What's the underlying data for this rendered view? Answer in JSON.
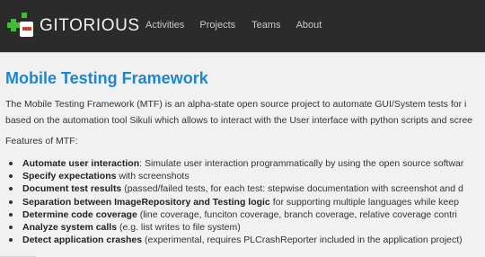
{
  "header": {
    "logo_text": "GITORIOUS",
    "logo_icon": "gitorious-plus-minus-icon",
    "nav": [
      {
        "label": "Activities"
      },
      {
        "label": "Projects"
      },
      {
        "label": "Teams"
      },
      {
        "label": "About"
      }
    ],
    "colors": {
      "bar": "#2b2b2b",
      "logo_green": "#3fbf2f",
      "logo_red": "#d23a2e"
    }
  },
  "main": {
    "title": "Mobile Testing Framework",
    "intro_line1": "The Mobile Testing Framework (MTF) is an alpha-state open source project to automate GUI/System tests for i",
    "intro_line2": "based on the automation tool Sikuli which allows to interact with the User interface with python scripts and scree",
    "features_label": "Features of MTF:",
    "features": [
      {
        "bold": "Automate user interaction",
        "text": ": Simulate user interaction programmatically by using the open source softwar"
      },
      {
        "bold": "Specify expectations",
        "text": " with screenshots"
      },
      {
        "bold": "Document test results",
        "text": " (passed/failed tests, for each test: stepwise documentation with screenshot and d"
      },
      {
        "bold": "Separation between ImageRepository and Testing logic",
        "text": " for supporting multiple languages while keep"
      },
      {
        "bold": "Determine code coverage",
        "text": " (line coverage, funciton coverage, branch coverage, relative coverage contri"
      },
      {
        "bold": "Analyze system calls",
        "text": " (e.g. list writes to file system)"
      },
      {
        "bold": "Detect application crashes",
        "text": " (experimental, requires PLCrashReporter included in the application project)"
      }
    ],
    "title_color": "#1e86cc"
  }
}
